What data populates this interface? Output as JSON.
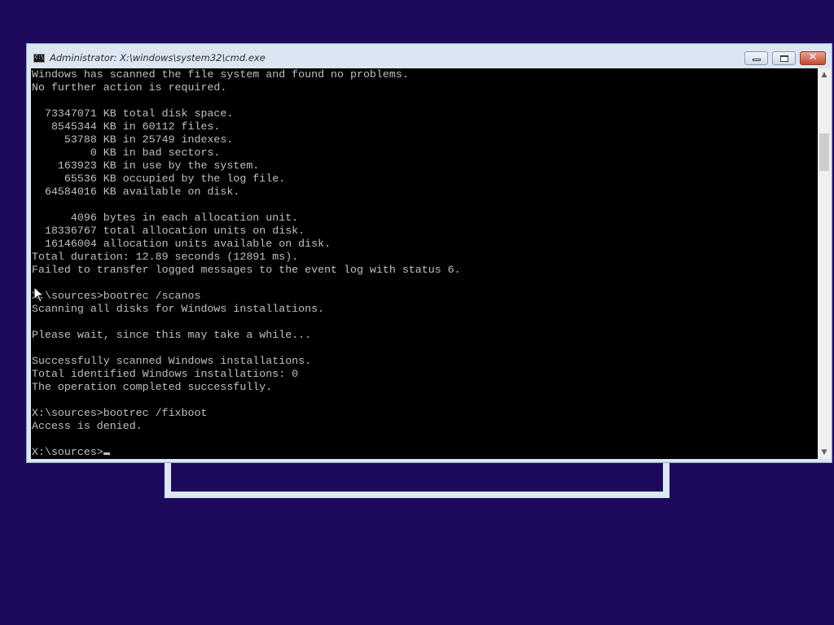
{
  "window": {
    "title": "Administrator: X:\\windows\\system32\\cmd.exe",
    "close_glyph": "✕"
  },
  "console": {
    "lines": [
      "Windows has scanned the file system and found no problems.",
      "No further action is required.",
      "",
      "  73347071 KB total disk space.",
      "   8545344 KB in 60112 files.",
      "     53788 KB in 25749 indexes.",
      "         0 KB in bad sectors.",
      "    163923 KB in use by the system.",
      "     65536 KB occupied by the log file.",
      "  64584016 KB available on disk.",
      "",
      "      4096 bytes in each allocation unit.",
      "  18336767 total allocation units on disk.",
      "  16146004 allocation units available on disk.",
      "Total duration: 12.89 seconds (12891 ms).",
      "Failed to transfer logged messages to the event log with status 6.",
      "",
      "X:\\sources>bootrec /scanos",
      "Scanning all disks for Windows installations.",
      "",
      "Please wait, since this may take a while...",
      "",
      "Successfully scanned Windows installations.",
      "Total identified Windows installations: 0",
      "The operation completed successfully.",
      "",
      "X:\\sources>bootrec /fixboot",
      "Access is denied.",
      "",
      "X:\\sources>"
    ]
  },
  "scrollbar": {
    "up_arrow": "▲",
    "down_arrow": "▼"
  },
  "icons": {
    "app_icon": "cmd-icon",
    "pointer": "mouse-pointer-icon"
  }
}
